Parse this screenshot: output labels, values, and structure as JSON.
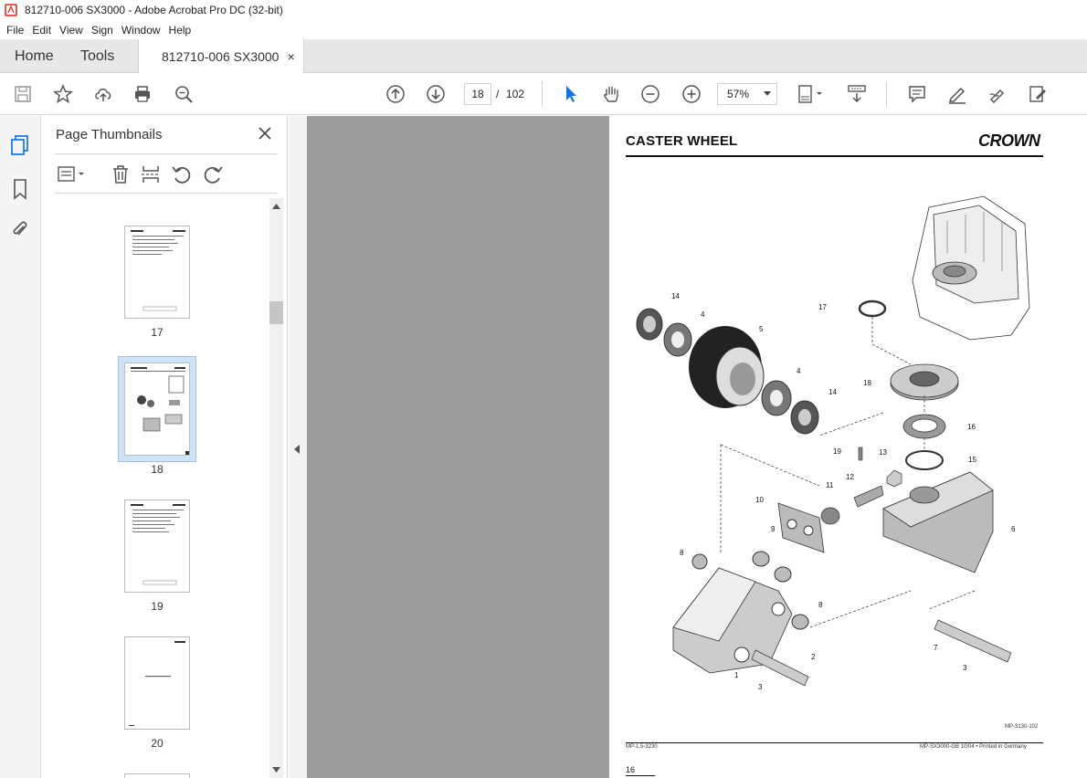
{
  "window": {
    "title": "812710-006 SX3000 - Adobe Acrobat Pro DC (32-bit)"
  },
  "menu": [
    "File",
    "Edit",
    "View",
    "Sign",
    "Window",
    "Help"
  ],
  "tabs": {
    "home": "Home",
    "tools": "Tools",
    "document": "812710-006 SX3000",
    "close_glyph": "×"
  },
  "toolbar": {
    "current_page": "18",
    "separator": "/",
    "total_pages": "102",
    "zoom": "57%"
  },
  "thumbnails_panel": {
    "title": "Page Thumbnails",
    "pages": [
      {
        "label": "17",
        "selected": false
      },
      {
        "label": "18",
        "selected": true
      },
      {
        "label": "19",
        "selected": false
      },
      {
        "label": "20",
        "selected": false
      }
    ]
  },
  "document": {
    "heading": "CASTER WHEEL",
    "brand": "CROWN",
    "figure_id": "MP-3130-102",
    "footer_left": "MP-1.5-3230",
    "footer_right": "MP-SX3000-GB 10/04 • Printed in Germany",
    "page_number": "16",
    "callouts": [
      "14",
      "4",
      "5",
      "4",
      "14",
      "17",
      "18",
      "16",
      "19",
      "13",
      "15",
      "12",
      "11",
      "10",
      "9",
      "6",
      "8",
      "8",
      "2",
      "3",
      "1",
      "7",
      "3"
    ]
  },
  "colors": {
    "accent_blue": "#1473e6",
    "selection": "#cfe3f7",
    "pdf_red": "#d7261e"
  }
}
